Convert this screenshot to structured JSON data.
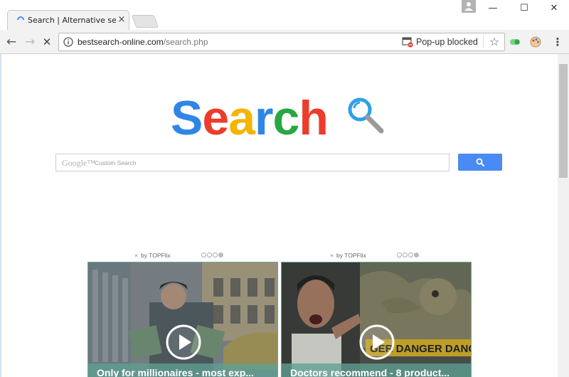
{
  "browser": {
    "tab_title": "Search | Alternative search",
    "tab_close": "×",
    "window_controls": {
      "minimize": "—",
      "maximize": "☐",
      "close": "✕"
    },
    "nav": {
      "back": "←",
      "forward": "→",
      "stop": "✕"
    },
    "url_host": "bestsearch-online.com",
    "url_path": "/search.php",
    "popup_blocked_text": "Pop-up blocked",
    "bookmark_star": "☆",
    "menu": "⋮",
    "icons": [
      "tab-favicon-icon",
      "info-icon",
      "popup-blocked-icon",
      "star-icon",
      "toggle-extension-icon",
      "palette-extension-icon",
      "menu-icon",
      "profile-icon"
    ]
  },
  "page": {
    "logo_letters": [
      {
        "char": "S",
        "color": "#2f86e6"
      },
      {
        "char": "e",
        "color": "#ec3c2c"
      },
      {
        "char": "a",
        "color": "#f4b400"
      },
      {
        "char": "r",
        "color": "#2f86e6"
      },
      {
        "char": "c",
        "color": "#27a844"
      },
      {
        "char": "h",
        "color": "#ec3c2c"
      }
    ],
    "search_brand": "Google™",
    "search_placeholder": "Custom Search",
    "search_button_color": "#4a8af4",
    "ads": [
      {
        "close": "×",
        "by_label": "by TOPFlix",
        "caption": "Only for millionaires - most exp..."
      },
      {
        "close": "×",
        "by_label": "by TOPFlix",
        "caption": "Doctors recommend - 8 product..."
      }
    ],
    "ad_sign_text": "GER DANGER DANG"
  }
}
